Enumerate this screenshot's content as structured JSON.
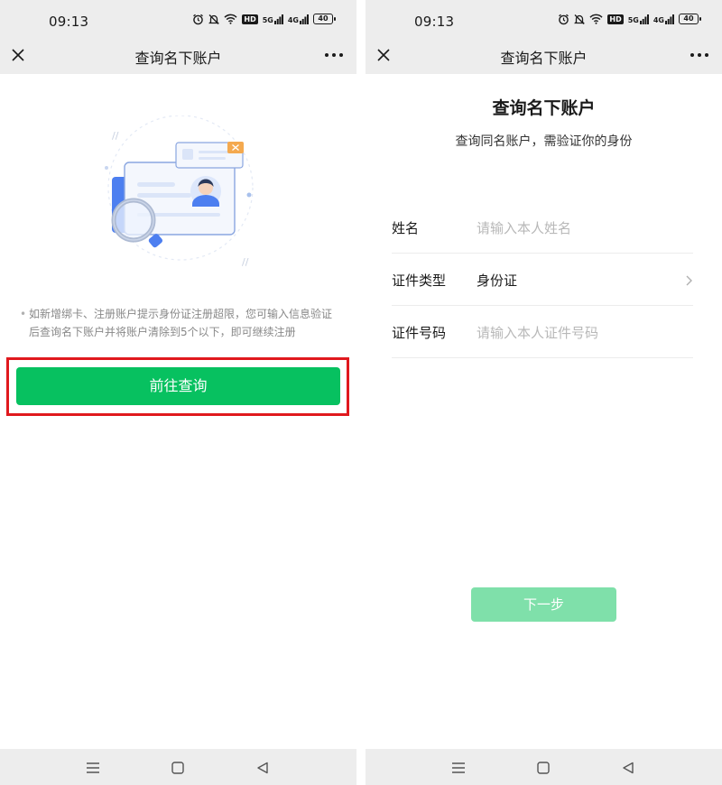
{
  "left": {
    "status": {
      "time": "09:13",
      "hd": "HD",
      "net5g": "5G",
      "net4g": "4G",
      "battery": "40"
    },
    "nav": {
      "title": "查询名下账户"
    },
    "notice": {
      "bullet": "•",
      "text": "如新增绑卡、注册账户提示身份证注册超限，您可输入信息验证后查询名下账户并将账户清除到5个以下，即可继续注册"
    },
    "button": {
      "label": "前往查询"
    }
  },
  "right": {
    "status": {
      "time": "09:13",
      "hd": "HD",
      "net5g": "5G",
      "net4g": "4G",
      "battery": "40"
    },
    "nav": {
      "title": "查询名下账户"
    },
    "title": "查询名下账户",
    "subtitle": "查询同名账户，需验证你的身份",
    "form": [
      {
        "label": "姓名",
        "placeholder": "请输入本人姓名",
        "value": ""
      },
      {
        "label": "证件类型",
        "placeholder": "",
        "value": "身份证"
      },
      {
        "label": "证件号码",
        "placeholder": "请输入本人证件号码",
        "value": ""
      }
    ],
    "next_button": {
      "label": "下一步"
    }
  },
  "icons": {
    "close": "close-icon",
    "more": "more-icon",
    "menu": "menu-icon",
    "home": "home-square-icon",
    "back": "back-triangle-icon",
    "chevron": "chevron-right-icon"
  },
  "colors": {
    "bar_bg": "#ededed",
    "primary": "#07c160",
    "primary_disabled": "#7fe0aa",
    "highlight": "#e0191e"
  }
}
